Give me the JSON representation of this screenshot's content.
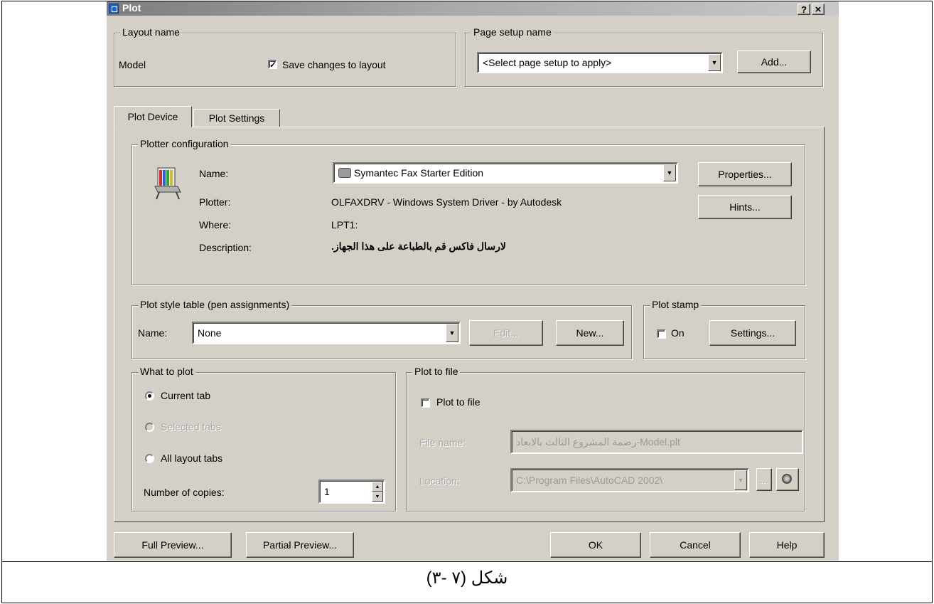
{
  "window": {
    "title": "Plot",
    "help_button": "?",
    "close_button": "×"
  },
  "layout_name": {
    "legend": "Layout name",
    "value": "Model",
    "save_changes_label": "Save changes to layout",
    "save_changes_checked": true
  },
  "page_setup": {
    "legend": "Page setup name",
    "selected": "<Select page setup to apply>",
    "add_label": "Add..."
  },
  "tabs": [
    {
      "label": "Plot Device",
      "active": true
    },
    {
      "label": "Plot Settings",
      "active": false
    }
  ],
  "plotter_config": {
    "legend": "Plotter configuration",
    "name_label": "Name:",
    "name_value": "Symantec Fax Starter Edition",
    "plotter_label": "Plotter:",
    "plotter_value": "OLFAXDRV - Windows System Driver - by Autodesk",
    "where_label": "Where:",
    "where_value": "LPT1:",
    "description_label": "Description:",
    "description_value": "لارسال فاكس قم بالطباعة على هذا الجهاز.",
    "properties_label": "Properties...",
    "hints_label": "Hints..."
  },
  "plot_style": {
    "legend": "Plot style table (pen assignments)",
    "name_label": "Name:",
    "value": "None",
    "edit_label": "Edit...",
    "new_label": "New..."
  },
  "plot_stamp": {
    "legend": "Plot stamp",
    "on_label": "On",
    "on_checked": false,
    "settings_label": "Settings..."
  },
  "what_to_plot": {
    "legend": "What to plot",
    "options": [
      {
        "label": "Current tab",
        "selected": true,
        "enabled": true
      },
      {
        "label": "Selected tabs",
        "selected": false,
        "enabled": false
      },
      {
        "label": "All layout tabs",
        "selected": false,
        "enabled": true
      }
    ],
    "copies_label": "Number of copies:",
    "copies_value": "1"
  },
  "plot_to_file": {
    "legend": "Plot to file",
    "checkbox_label": "Plot to file",
    "checked": false,
    "file_name_label": "File name:",
    "file_name_value": "رصمة المشروع الثالث بالابعاد-Model.plt",
    "location_label": "Location:",
    "location_value": "C:\\Program Files\\AutoCAD 2002\\",
    "browse_label": "..."
  },
  "footer_buttons": {
    "full_preview": "Full Preview...",
    "partial_preview": "Partial Preview...",
    "ok": "OK",
    "cancel": "Cancel",
    "help": "Help"
  },
  "caption": "شكل (٧ -٣)"
}
